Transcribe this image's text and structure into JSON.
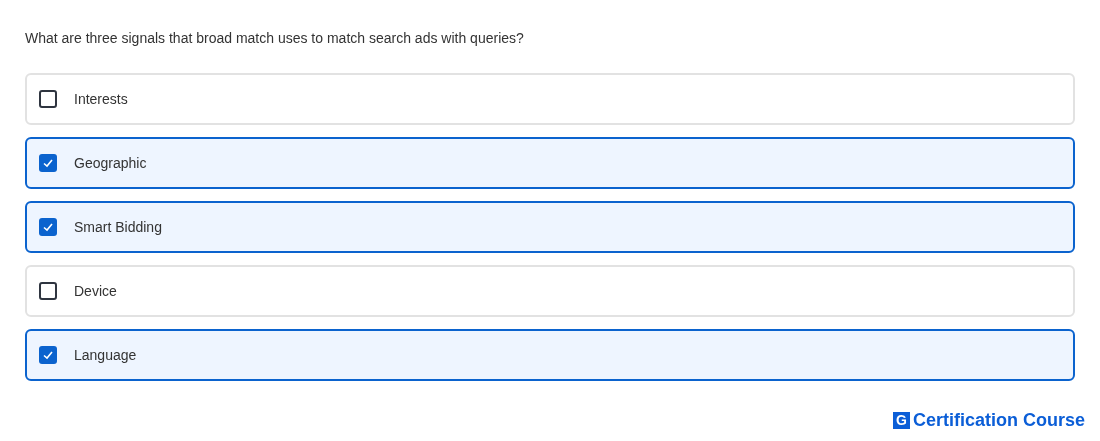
{
  "question": "What are three signals that broad match uses to match search ads with queries?",
  "options": [
    {
      "label": "Interests",
      "checked": false
    },
    {
      "label": "Geographic",
      "checked": true
    },
    {
      "label": "Smart Bidding",
      "checked": true
    },
    {
      "label": "Device",
      "checked": false
    },
    {
      "label": "Language",
      "checked": true
    }
  ],
  "logo": {
    "mark": "G",
    "text": "Certification Course"
  }
}
